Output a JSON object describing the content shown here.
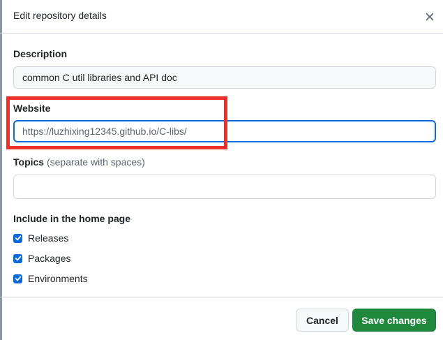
{
  "dialog": {
    "title": "Edit repository details",
    "close_icon": "close-icon"
  },
  "description": {
    "label": "Description",
    "value": "common C util libraries and API doc"
  },
  "website": {
    "label": "Website",
    "value": "https://luzhixing12345.github.io/C-libs/"
  },
  "topics": {
    "label": "Topics",
    "note": "(separate with spaces)",
    "value": ""
  },
  "home_page": {
    "heading": "Include in the home page",
    "options": [
      {
        "label": "Releases",
        "checked": true
      },
      {
        "label": "Packages",
        "checked": true
      },
      {
        "label": "Environments",
        "checked": true
      }
    ]
  },
  "footer": {
    "cancel_label": "Cancel",
    "save_label": "Save changes"
  },
  "colors": {
    "accent": "#0969da",
    "save_button": "#1f883d",
    "highlight": "#e8322d"
  }
}
